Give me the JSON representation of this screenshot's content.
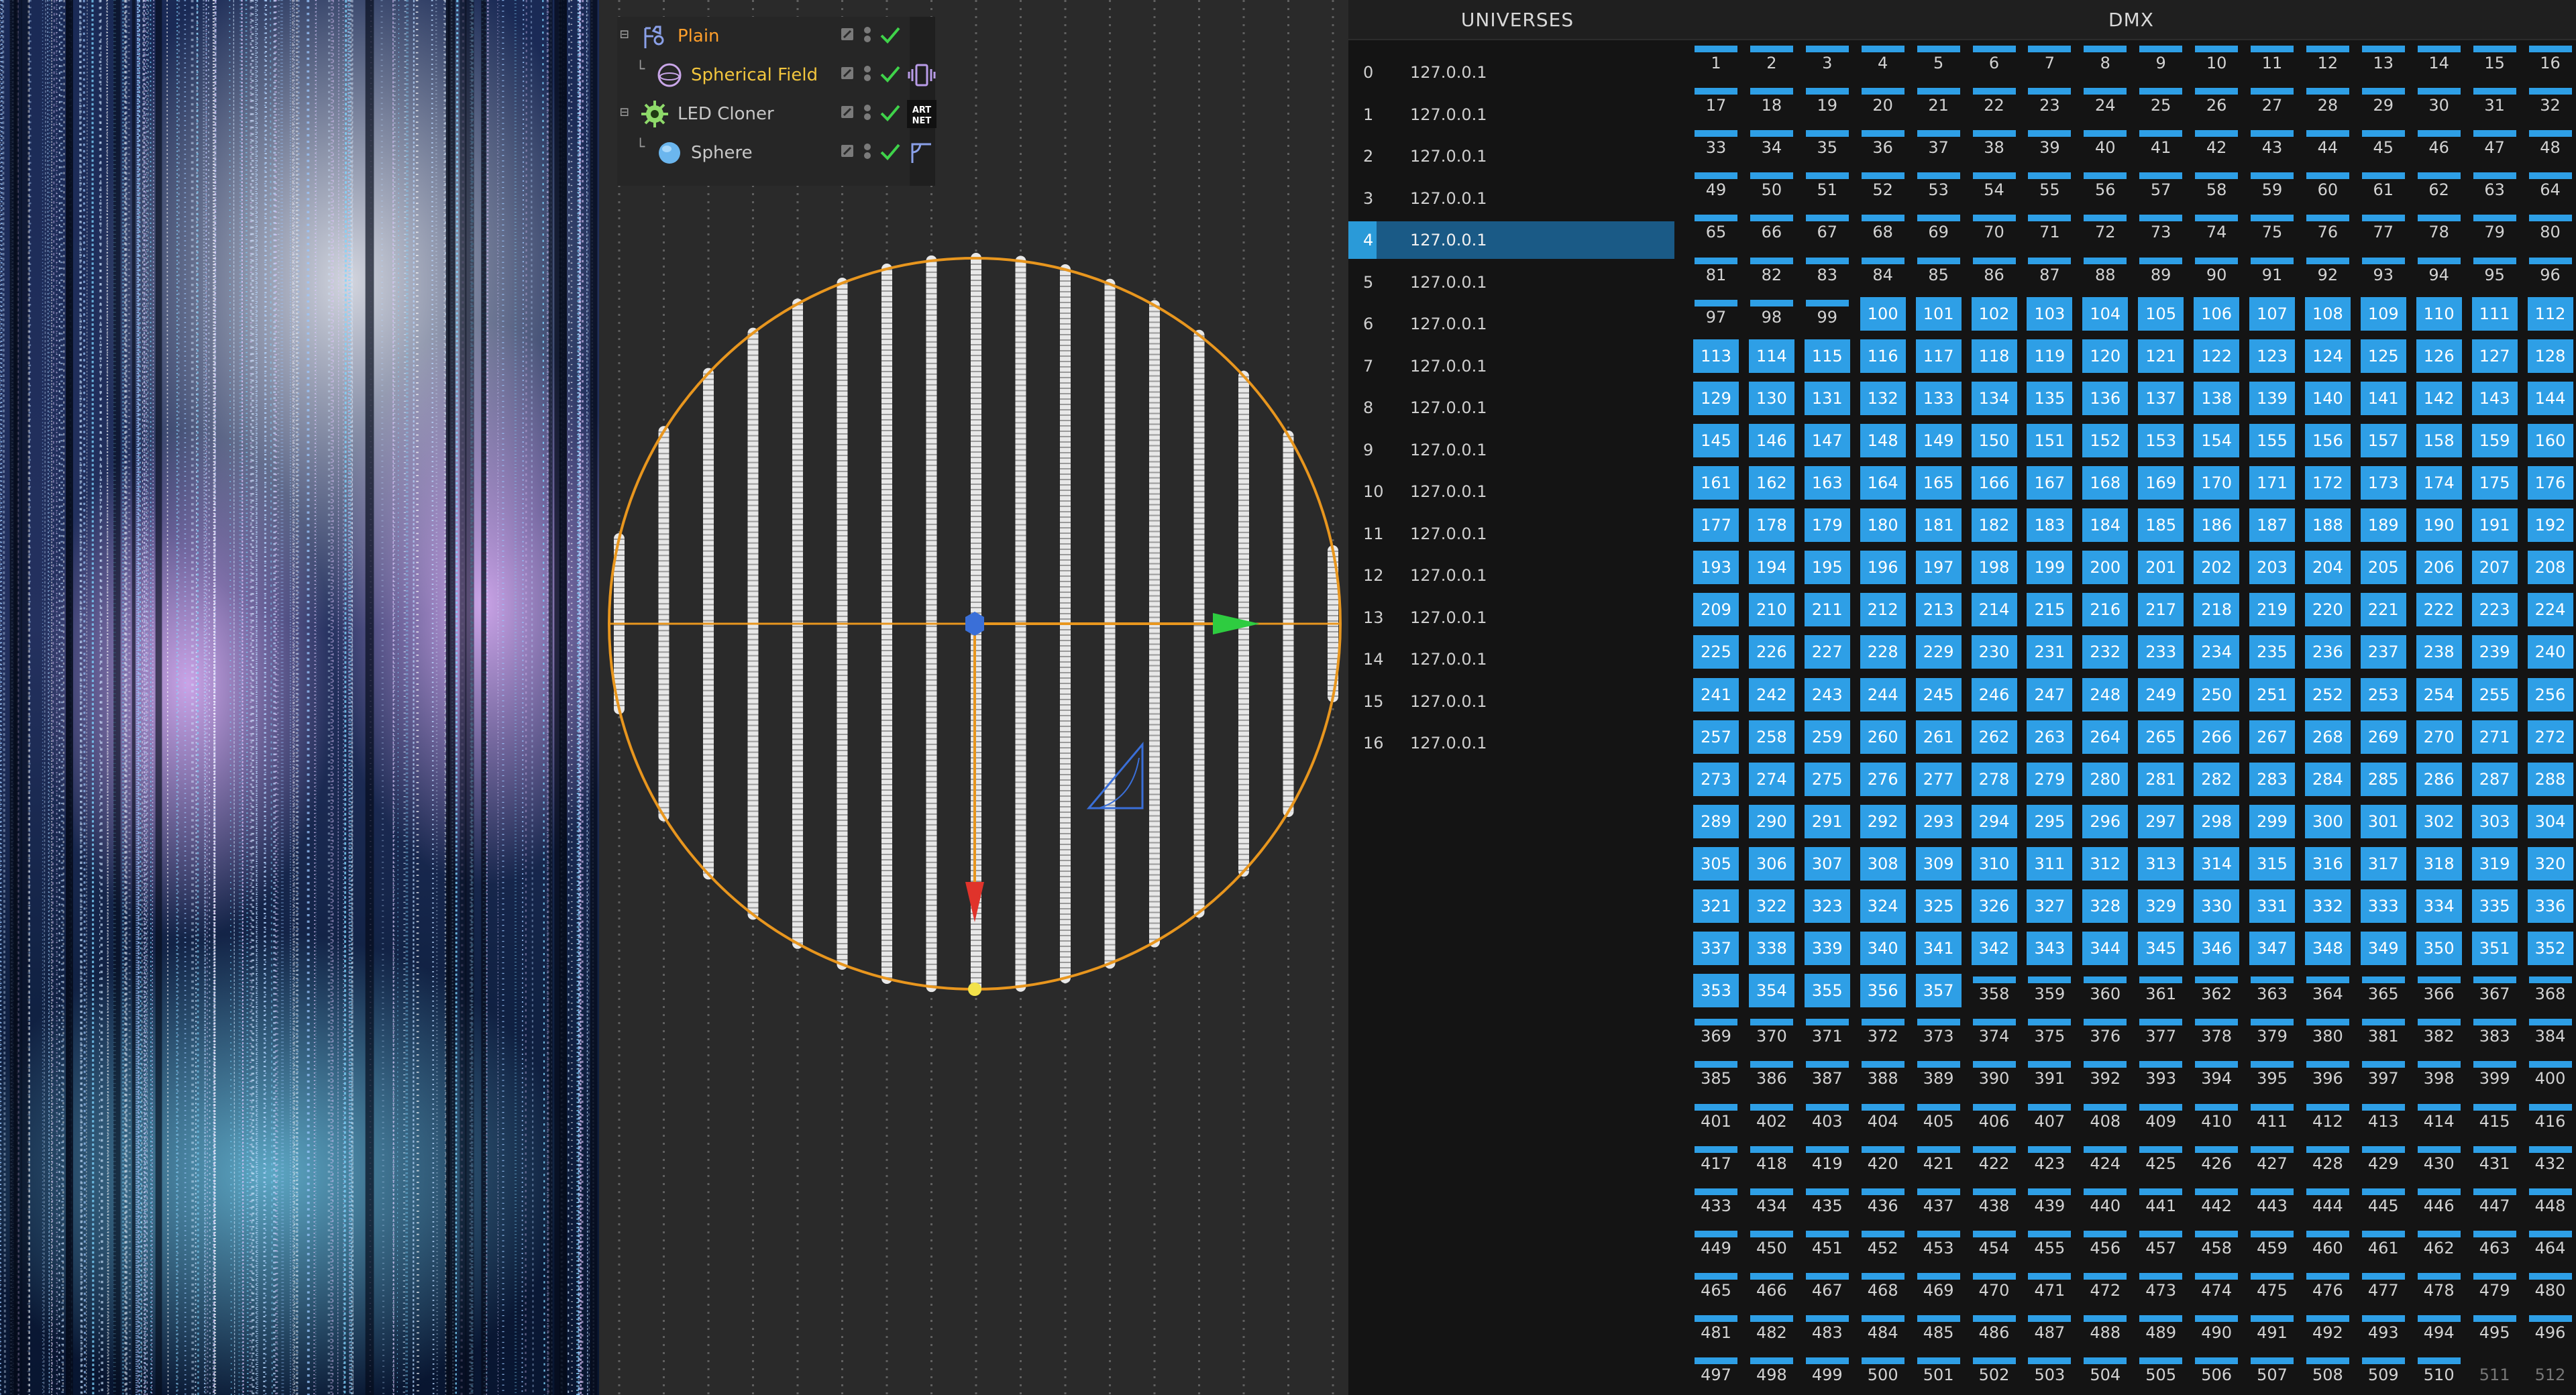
{
  "object_manager": {
    "items": [
      {
        "label": "Plain",
        "icon": "plain-effector-icon",
        "tag": "vibrate-tag-icon"
      },
      {
        "label": "Spherical Field",
        "icon": "spherical-field-icon",
        "tag": "vibrate-tag-icon"
      },
      {
        "label": "LED Cloner",
        "icon": "cloner-gear-icon",
        "tag": "artnet-tag-icon",
        "tag_text": "ART NET"
      },
      {
        "label": "Sphere",
        "icon": "sphere-icon",
        "tag": "phong-tag-icon"
      }
    ]
  },
  "universes": {
    "header": "UNIVERSES",
    "selected_index": 4,
    "rows": [
      {
        "index": "0",
        "ip": "127.0.0.1"
      },
      {
        "index": "1",
        "ip": "127.0.0.1"
      },
      {
        "index": "2",
        "ip": "127.0.0.1"
      },
      {
        "index": "3",
        "ip": "127.0.0.1"
      },
      {
        "index": "4",
        "ip": "127.0.0.1"
      },
      {
        "index": "5",
        "ip": "127.0.0.1"
      },
      {
        "index": "6",
        "ip": "127.0.0.1"
      },
      {
        "index": "7",
        "ip": "127.0.0.1"
      },
      {
        "index": "8",
        "ip": "127.0.0.1"
      },
      {
        "index": "9",
        "ip": "127.0.0.1"
      },
      {
        "index": "10",
        "ip": "127.0.0.1"
      },
      {
        "index": "11",
        "ip": "127.0.0.1"
      },
      {
        "index": "12",
        "ip": "127.0.0.1"
      },
      {
        "index": "13",
        "ip": "127.0.0.1"
      },
      {
        "index": "14",
        "ip": "127.0.0.1"
      },
      {
        "index": "15",
        "ip": "127.0.0.1"
      },
      {
        "index": "16",
        "ip": "127.0.0.1"
      }
    ]
  },
  "dmx": {
    "header": "DMX",
    "channel_count": 512,
    "partial_range": [
      1,
      99
    ],
    "full_range": [
      100,
      357
    ],
    "unlit_channels": [
      511,
      512
    ],
    "accent_color": "#2e9fe6"
  },
  "colors": {
    "field_orange": "#e8961e",
    "axis_x_green": "#2ecc40",
    "axis_y_red": "#e0332b",
    "axis_z_blue": "#3a6fd8"
  }
}
